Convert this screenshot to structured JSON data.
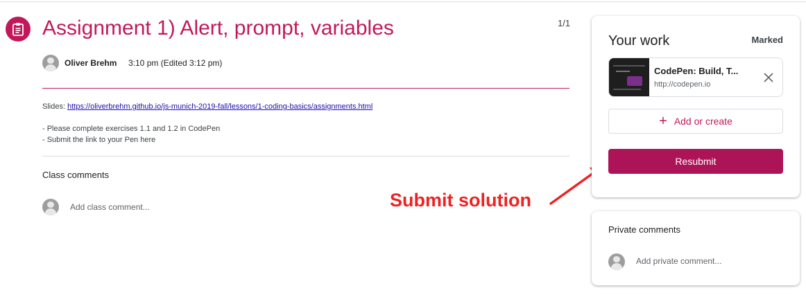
{
  "assignment": {
    "title": "Assignment 1) Alert, prompt, variables",
    "pager": "1/1",
    "icon": "assignment-icon",
    "accent_color": "#c2185b"
  },
  "author": {
    "name": "Oliver Brehm",
    "time": "3:10 pm (Edited 3:12 pm)"
  },
  "description": {
    "slides_label": "Slides:",
    "slides_link": "https://oliverbrehm.github.io/js-munich-2019-fall/lessons/1-coding-basics/assignments.html",
    "lines": [
      "- Please complete exercises 1.1 and 1.2 in CodePen",
      "- Submit the link to your Pen here"
    ]
  },
  "class_comments": {
    "heading": "Class comments",
    "placeholder": "Add class comment..."
  },
  "annotation": {
    "text": "Submit solution",
    "color": "#ee2222"
  },
  "your_work": {
    "heading": "Your work",
    "status": "Marked",
    "attachment": {
      "title": "CodePen: Build, T...",
      "url": "http://codepen.io"
    },
    "add_label": "Add or create",
    "submit_label": "Resubmit",
    "submit_color": "#ad1457"
  },
  "private_comments": {
    "heading": "Private comments",
    "placeholder": "Add private comment..."
  }
}
